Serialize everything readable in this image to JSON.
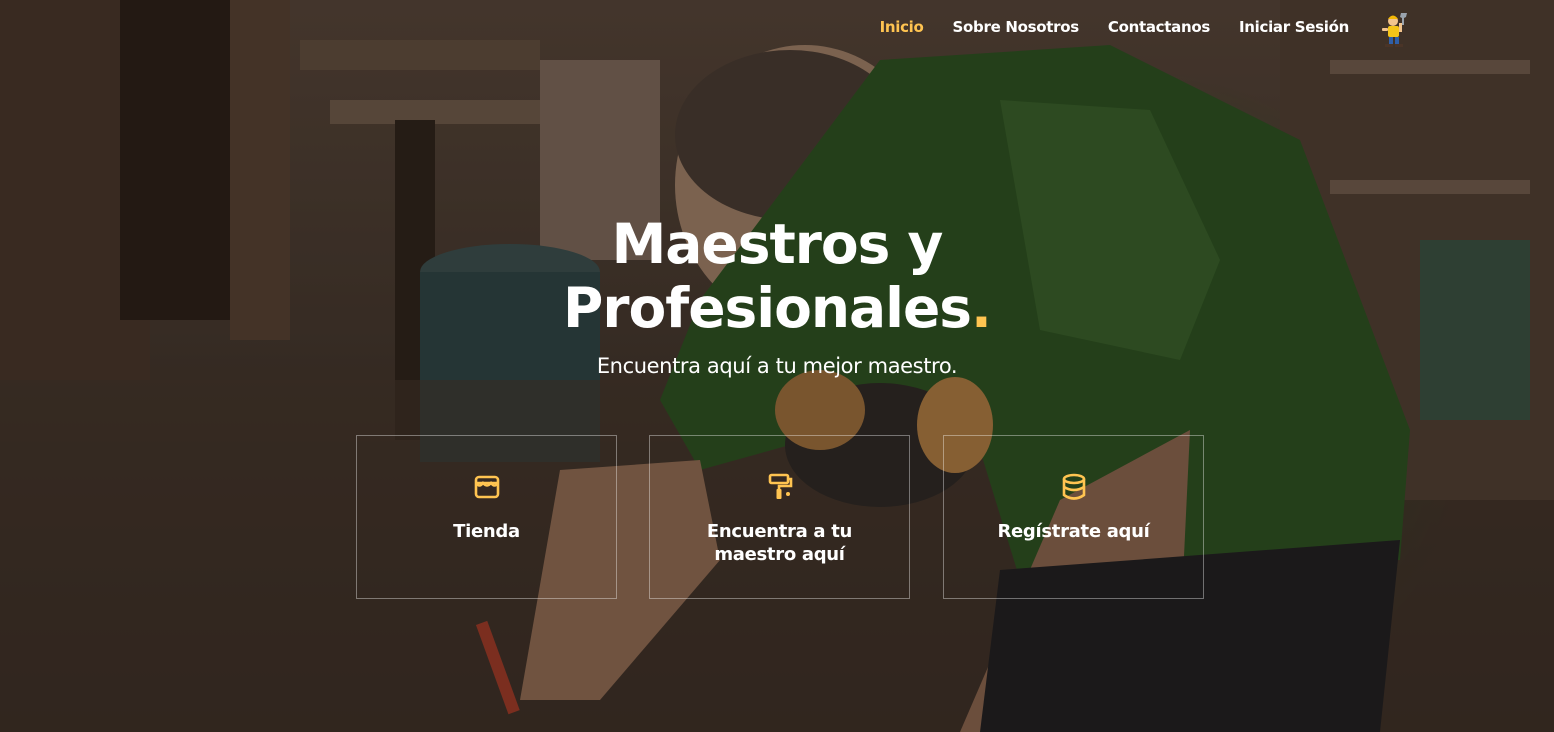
{
  "nav": {
    "items": [
      {
        "label": "Inicio",
        "active": true
      },
      {
        "label": "Sobre Nosotros",
        "active": false
      },
      {
        "label": "Contactanos",
        "active": false
      },
      {
        "label": "Iniciar Sesión",
        "active": false
      }
    ],
    "logo_icon": "handyman-mascot-icon"
  },
  "hero": {
    "title_line1": "Maestros y",
    "title_line2": "Profesionales",
    "title_dot": ".",
    "subtitle": "Encuentra aquí a tu mejor maestro."
  },
  "boxes": [
    {
      "label": "Tienda",
      "icon": "store-icon"
    },
    {
      "label": "Encuentra a tu maestro aquí",
      "icon": "paint-roller-icon"
    },
    {
      "label": "Regístrate aquí",
      "icon": "database-icon"
    }
  ],
  "colors": {
    "accent": "#ffc451",
    "text": "#ffffff",
    "box_border": "rgba(255,255,255,0.38)"
  }
}
